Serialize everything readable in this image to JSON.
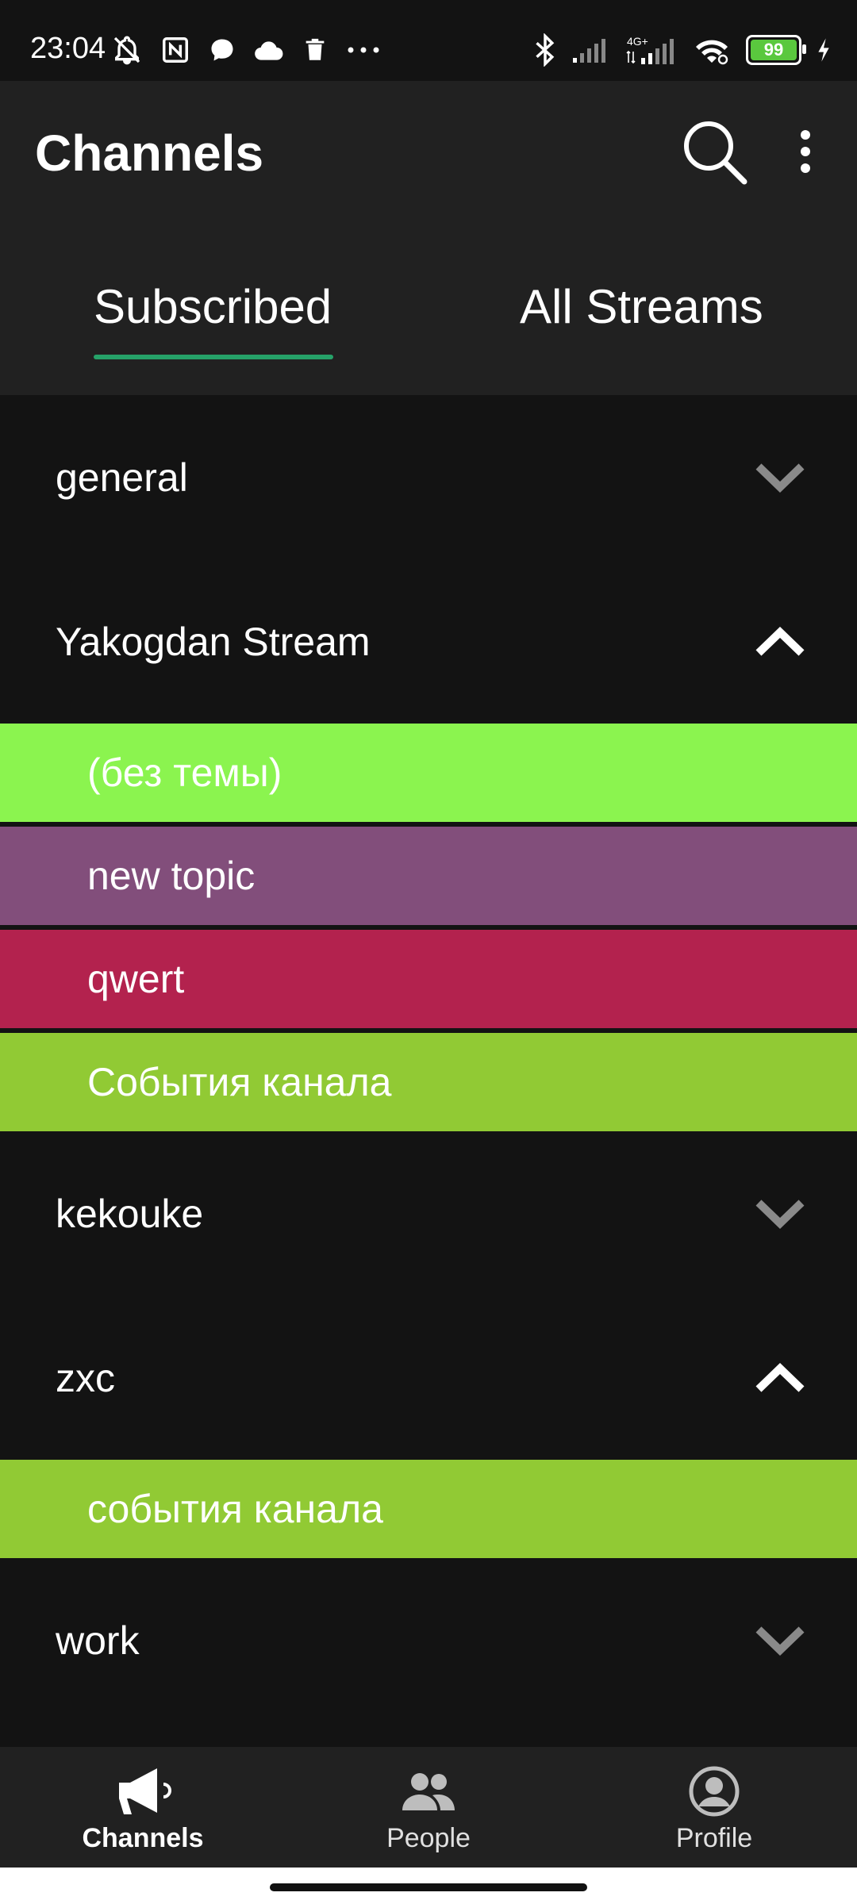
{
  "status_bar": {
    "time": "23:04",
    "icons_left": [
      "notifications-off-icon",
      "nfc-icon",
      "chat-bubble-icon",
      "cloud-icon",
      "trash-icon",
      "more-dots-icon"
    ],
    "icons_right": [
      "bluetooth-icon",
      "signal-icon",
      "signal-4g-icon",
      "wifi-icon",
      "battery-icon",
      "charging-icon"
    ],
    "network": "4G+",
    "battery_level": "99"
  },
  "app_bar": {
    "title": "Channels",
    "search_icon": "search-icon",
    "more_icon": "more-vert-icon"
  },
  "tabs": [
    {
      "label": "Subscribed",
      "selected": true
    },
    {
      "label": "All Streams",
      "selected": false
    }
  ],
  "accent_color": "#26a269",
  "streams": [
    {
      "name": "general",
      "expanded": false,
      "topics": []
    },
    {
      "name": "Yakogdan Stream",
      "expanded": true,
      "topics": [
        {
          "label": "(без темы)",
          "color": "#8bf44f"
        },
        {
          "label": "new topic",
          "color": "#824e7b"
        },
        {
          "label": "qwert",
          "color": "#b3224e"
        },
        {
          "label": "События канала",
          "color": "#91ca34"
        }
      ]
    },
    {
      "name": "kekouke",
      "expanded": false,
      "topics": []
    },
    {
      "name": "zxc",
      "expanded": true,
      "topics": [
        {
          "label": "события канала",
          "color": "#91ca34"
        }
      ]
    },
    {
      "name": "work",
      "expanded": false,
      "topics": []
    }
  ],
  "bottom_nav": [
    {
      "label": "Channels",
      "icon": "megaphone-icon",
      "selected": true
    },
    {
      "label": "People",
      "icon": "people-icon",
      "selected": false
    },
    {
      "label": "Profile",
      "icon": "profile-icon",
      "selected": false
    }
  ]
}
